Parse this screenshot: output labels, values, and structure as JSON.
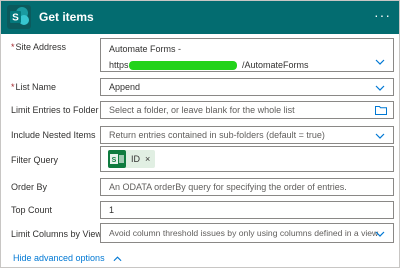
{
  "header": {
    "title": "Get items",
    "more": "···"
  },
  "site_address": {
    "label": "Site Address",
    "line1": "Automate Forms -",
    "line2_prefix": "https",
    "line2_suffix": "/AutomateForms"
  },
  "list_name": {
    "label": "List Name",
    "value": "Append"
  },
  "limit_folder": {
    "label": "Limit Entries to Folder",
    "placeholder": "Select a folder, or leave blank for the whole list"
  },
  "nested": {
    "label": "Include Nested Items",
    "placeholder": "Return entries contained in sub-folders (default = true)"
  },
  "filter_query": {
    "label": "Filter Query",
    "token_label": "ID",
    "token_remove": "×"
  },
  "order_by": {
    "label": "Order By",
    "placeholder": "An ODATA orderBy query for specifying the order of entries."
  },
  "top_count": {
    "label": "Top Count",
    "value": "1"
  },
  "limit_columns": {
    "label": "Limit Columns by View",
    "placeholder": "Avoid column threshold issues by only using columns defined in a view"
  },
  "advanced": {
    "label": "Hide advanced options",
    "chevron": "^"
  },
  "colors": {
    "header": "#036c70",
    "link": "#0078d4",
    "chevron": "#0078d4",
    "token_bg": "#e1efe3"
  }
}
